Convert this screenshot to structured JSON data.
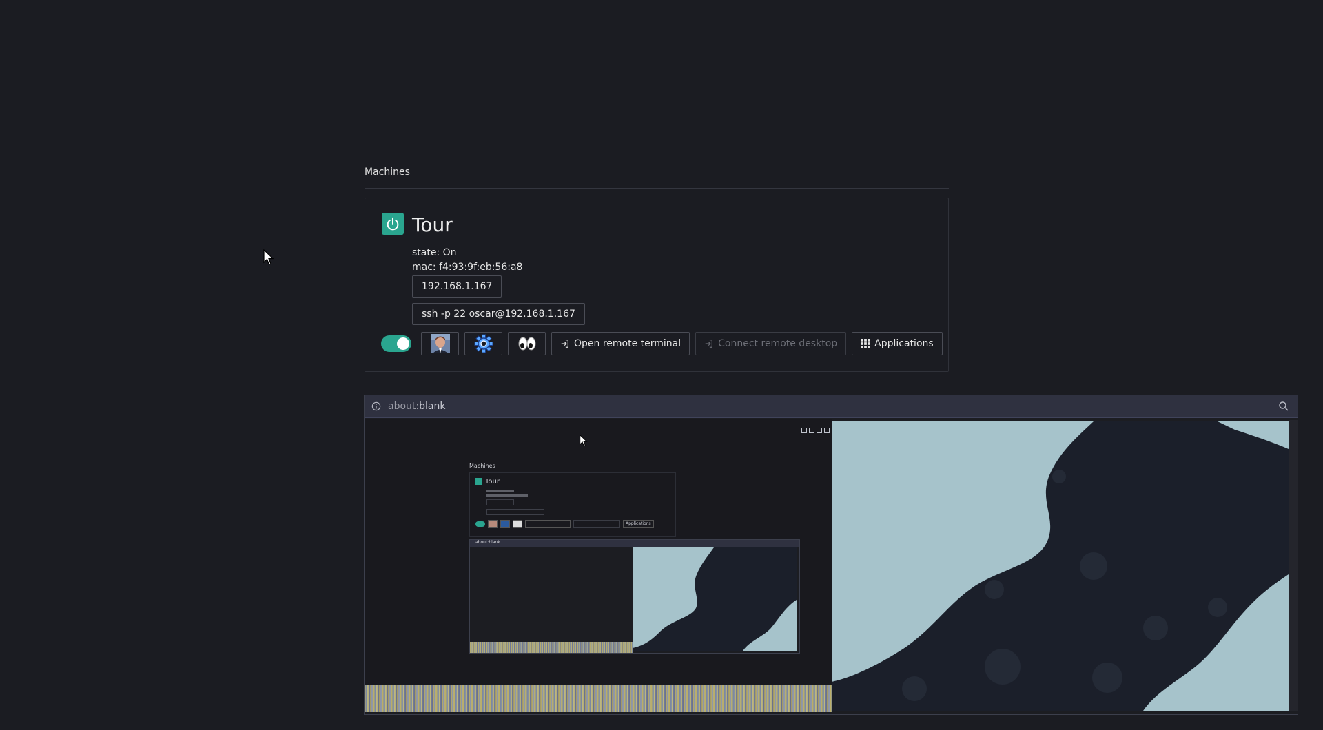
{
  "section": {
    "title": "Machines"
  },
  "machine": {
    "name": "Tour",
    "state_line": "state: On",
    "mac_line": "mac: f4:93:9f:eb:56:a8",
    "ip": "192.168.1.167",
    "ssh": "ssh -p 22 oscar@192.168.1.167",
    "toggle_on": true,
    "icons": [
      "avatar-icon",
      "gear-icon",
      "eyes-icon"
    ],
    "buttons": {
      "open_terminal": "Open remote terminal",
      "connect_desktop": "Connect remote desktop",
      "applications": "Applications"
    }
  },
  "viewer": {
    "url_prefix": "about:",
    "url_suffix": "blank"
  },
  "mini": {
    "section_title": "Machines",
    "machine_name": "Tour",
    "apps": "Applications",
    "url": "about:blank"
  },
  "colors": {
    "background": "#1b1c22",
    "accent": "#2aa58f",
    "viewer_bar": "#2f3140",
    "fractal_light": "#a6c3cb",
    "fractal_dark": "#1b1f2a"
  }
}
